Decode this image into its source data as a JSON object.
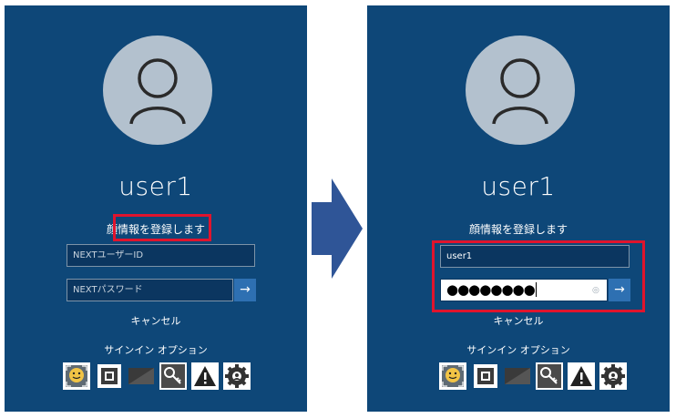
{
  "colors": {
    "panel_bg": "#0e4778",
    "avatar_bg": "#b3c1ce",
    "highlight": "#e0142d",
    "submit_btn": "#2e70b2",
    "arrow": "#2f5597"
  },
  "left": {
    "username": "user1",
    "face_link": "顔情報を登録します",
    "user_id_placeholder": "NEXTユーザーID",
    "password_placeholder": "NEXTパスワード",
    "submit_icon": "→",
    "cancel": "キャンセル",
    "signin_options_label": "サインイン オプション",
    "signin_options": [
      "face-icon",
      "pin-icon",
      "smart-card-icon",
      "key-icon",
      "warning-icon",
      "settings-icon"
    ]
  },
  "right": {
    "username": "user1",
    "face_link": "顔情報を登録します",
    "user_id_value": "user1",
    "password_masked": "●●●●●●●●",
    "reveal_icon": "eye-icon",
    "submit_icon": "→",
    "cancel": "キャンセル",
    "signin_options_label": "サインイン オプション",
    "signin_options": [
      "face-icon",
      "pin-icon",
      "smart-card-icon",
      "key-icon",
      "warning-icon",
      "settings-icon"
    ]
  },
  "transition_icon": "right-arrow-icon"
}
